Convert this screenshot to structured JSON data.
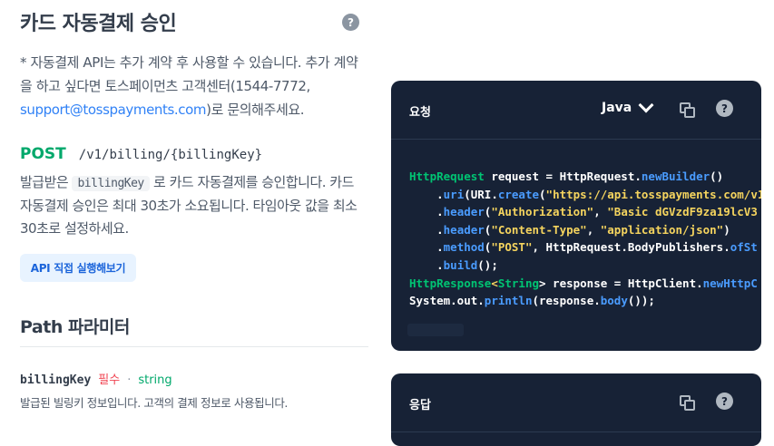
{
  "header": {
    "title": "카드 자동결제 승인",
    "help_icon": "?"
  },
  "description": {
    "text_before_link": "* 자동결제 API는 추가 계약 후 사용할 수 있습니다. 추가 계약을 하고 싶다면 토스페이먼츠 고객센터(1544-7772,",
    "link_text": "support@tosspayments.com",
    "text_after_link": ")로 문의해주세요."
  },
  "endpoint": {
    "method": "POST",
    "path": "/v1/billing/{billingKey}"
  },
  "endpoint_desc": {
    "before_chip": "발급받은",
    "chip": "billingKey",
    "after_chip": "로 카드 자동결제를 승인합니다. 카드 자동결제 승인은 최대 30초가 소요됩니다. 타임아웃 값을 최소 30초로 설정하세요."
  },
  "try_button": "API 직접 실행해보기",
  "path_params": {
    "section_title": "Path 파라미터",
    "name": "billingKey",
    "required": "필수",
    "separator": "·",
    "type": "string",
    "desc": "발급된 빌링키 정보입니다. 고객의 결제 정보로 사용됩니다."
  },
  "request_panel": {
    "title": "요청",
    "language": "Java",
    "help_icon": "?"
  },
  "response_panel": {
    "title": "응답",
    "help_icon": "?"
  },
  "code_tokens": {
    "l1a": "HttpRequest",
    "l1b": " request = HttpRequest.",
    "l1c": "newBuilder",
    "l1d": "()",
    "l2a": "    .",
    "l2b": "uri",
    "l2c": "(URI.",
    "l2d": "create",
    "l2e": "(",
    "l2f": "\"https://api.tosspayments.com/v1",
    "l3a": "    .",
    "l3b": "header",
    "l3c": "(",
    "l3d": "\"Authorization\"",
    "l3e": ", ",
    "l3f": "\"Basic dGVzdF9za19lcV3",
    "l4a": "    .",
    "l4b": "header",
    "l4c": "(",
    "l4d": "\"Content-Type\"",
    "l4e": ", ",
    "l4f": "\"application/json\"",
    "l4g": ")",
    "l5a": "    .",
    "l5b": "method",
    "l5c": "(",
    "l5d": "\"POST\"",
    "l5e": ", HttpRequest.BodyPublishers.",
    "l5f": "ofSt",
    "l6a": "    .",
    "l6b": "build",
    "l6c": "();",
    "l7a": "HttpResponse",
    "l7b": "<",
    "l7c": "String",
    "l7d": "> response = HttpClient.",
    "l7e": "newHttpC",
    "l8a": "System.out.",
    "l8b": "println",
    "l8c": "(response.",
    "l8d": "body",
    "l8e": "());"
  },
  "colors": {
    "panel_bg": "#172236",
    "link": "#3182f6",
    "method": "#00a86b",
    "required": "#f04452",
    "code_green": "#00c473",
    "code_blue": "#4a9cff",
    "code_yellow": "#f5d45e"
  }
}
